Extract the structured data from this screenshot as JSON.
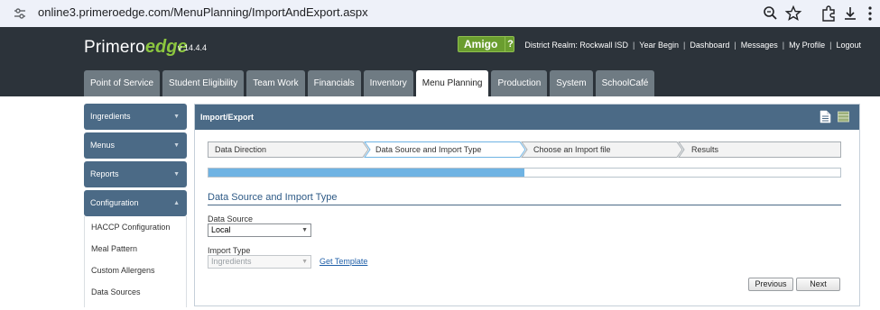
{
  "browser": {
    "url": "online3.primeroedge.com/MenuPlanning/ImportAndExport.aspx",
    "icons": [
      "tune-icon",
      "zoom-icon",
      "star-icon",
      "extensions-icon",
      "download-icon",
      "menu-dots-icon"
    ]
  },
  "header": {
    "logo_primary": "Primero",
    "logo_accent": "edge",
    "version": "v 14.4.4",
    "amigo_label": "Amigo",
    "amigo_help": "?",
    "links": [
      "District Realm: Rockwall ISD",
      "Year Begin",
      "Dashboard",
      "Messages",
      "My Profile",
      "Logout"
    ],
    "tabs": [
      "Point of Service",
      "Student Eligibility",
      "Team Work",
      "Financials",
      "Inventory",
      "Menu Planning",
      "Production",
      "System",
      "SchoolCafé"
    ],
    "active_tab": "Menu Planning"
  },
  "sidebar": {
    "sections": [
      "Ingredients",
      "Menus",
      "Reports",
      "Configuration"
    ],
    "config_items": [
      "HACCP Configuration",
      "Meal Pattern",
      "Custom Allergens",
      "Data Sources"
    ]
  },
  "panel": {
    "title": "Import/Export",
    "icons": [
      "document-icon",
      "grid-icon"
    ],
    "steps": [
      "Data Direction",
      "Data Source and Import Type",
      "Choose an Import file",
      "Results"
    ],
    "current_step": 2,
    "progress": 0.5,
    "section_title": "Data Source and Import Type",
    "data_source_label": "Data Source",
    "data_source_value": "Local",
    "import_type_label": "Import Type",
    "import_type_value": "Ingredients",
    "get_template": "Get Template",
    "previous": "Previous",
    "next": "Next"
  },
  "colors": {
    "header_bg": "#2c333a",
    "nav_blue": "#4b6a86",
    "accent_green": "#8cc63f",
    "progress": "#6fb3e3"
  }
}
